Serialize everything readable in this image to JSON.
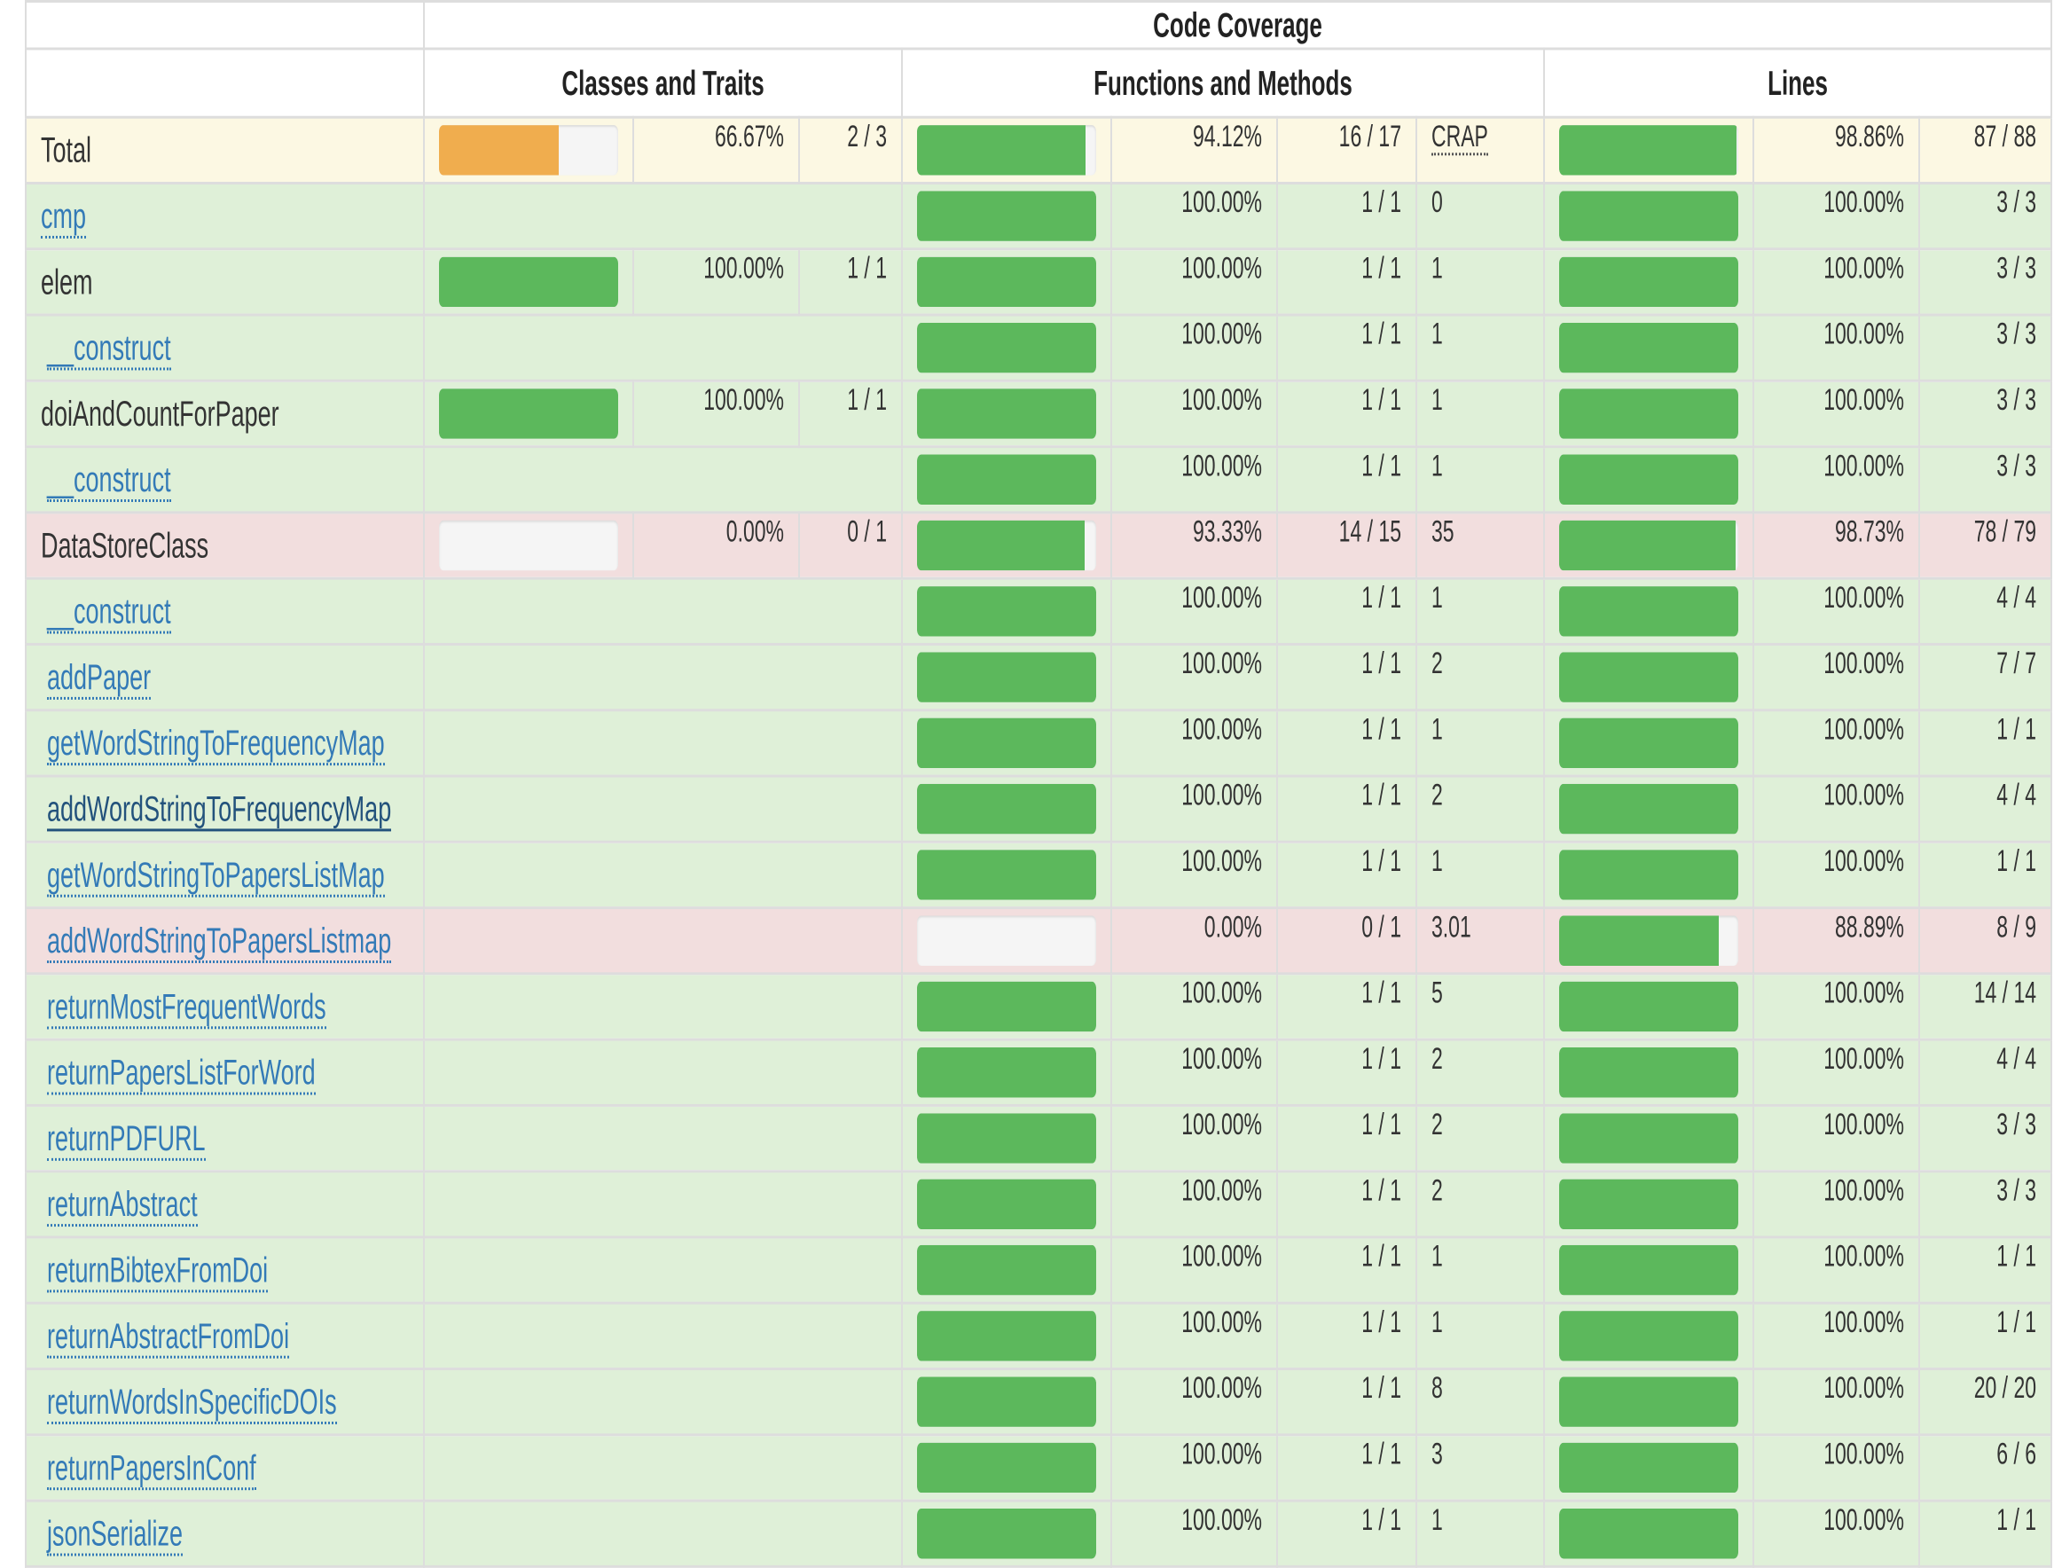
{
  "header": {
    "code_coverage": "Code Coverage",
    "classes_and_traits": "Classes and Traits",
    "functions_and_methods": "Functions and Methods",
    "lines": "Lines"
  },
  "colors": {
    "success_bar": "#5cb85c",
    "warning_bar": "#f0ad4e",
    "success_row": "#dff0d8",
    "warning_row": "#fcf8e3",
    "danger_row": "#f2dede",
    "link": "#337ab7"
  },
  "rows": [
    {
      "name": "Total",
      "link": false,
      "indent": false,
      "status": "warning",
      "classes": {
        "show": true,
        "pct": "66.67%",
        "frac": "2 / 3",
        "level": 0.6667,
        "color": "warning"
      },
      "methods": {
        "level": 0.9412,
        "pct": "94.12%",
        "frac": "16 / 17",
        "crap": "CRAP",
        "crap_abbr": true
      },
      "lines": {
        "level": 0.9886,
        "pct": "98.86%",
        "frac": "87 / 88"
      }
    },
    {
      "name": "cmp",
      "link": true,
      "indent": false,
      "status": "success",
      "classes": {
        "show": false
      },
      "methods": {
        "level": 1.0,
        "pct": "100.00%",
        "frac": "1 / 1",
        "crap": "0"
      },
      "lines": {
        "level": 1.0,
        "pct": "100.00%",
        "frac": "3 / 3"
      }
    },
    {
      "name": "elem",
      "link": false,
      "indent": false,
      "status": "success",
      "classes": {
        "show": true,
        "pct": "100.00%",
        "frac": "1 / 1",
        "level": 1.0,
        "color": "success"
      },
      "methods": {
        "level": 1.0,
        "pct": "100.00%",
        "frac": "1 / 1",
        "crap": "1"
      },
      "lines": {
        "level": 1.0,
        "pct": "100.00%",
        "frac": "3 / 3"
      }
    },
    {
      "name": "__construct",
      "link": true,
      "indent": true,
      "status": "success",
      "classes": {
        "show": false
      },
      "methods": {
        "level": 1.0,
        "pct": "100.00%",
        "frac": "1 / 1",
        "crap": "1"
      },
      "lines": {
        "level": 1.0,
        "pct": "100.00%",
        "frac": "3 / 3"
      }
    },
    {
      "name": "doiAndCountForPaper",
      "link": false,
      "indent": false,
      "status": "success",
      "classes": {
        "show": true,
        "pct": "100.00%",
        "frac": "1 / 1",
        "level": 1.0,
        "color": "success"
      },
      "methods": {
        "level": 1.0,
        "pct": "100.00%",
        "frac": "1 / 1",
        "crap": "1"
      },
      "lines": {
        "level": 1.0,
        "pct": "100.00%",
        "frac": "3 / 3"
      }
    },
    {
      "name": "__construct",
      "link": true,
      "indent": true,
      "status": "success",
      "classes": {
        "show": false
      },
      "methods": {
        "level": 1.0,
        "pct": "100.00%",
        "frac": "1 / 1",
        "crap": "1"
      },
      "lines": {
        "level": 1.0,
        "pct": "100.00%",
        "frac": "3 / 3"
      }
    },
    {
      "name": "DataStoreClass",
      "link": false,
      "indent": false,
      "status": "danger",
      "classes": {
        "show": true,
        "pct": "0.00%",
        "frac": "0 / 1",
        "level": 0.0,
        "color": "success"
      },
      "methods": {
        "level": 0.9333,
        "pct": "93.33%",
        "frac": "14 / 15",
        "crap": "35"
      },
      "lines": {
        "level": 0.9873,
        "pct": "98.73%",
        "frac": "78 / 79"
      }
    },
    {
      "name": "__construct",
      "link": true,
      "indent": true,
      "status": "success",
      "classes": {
        "show": false
      },
      "methods": {
        "level": 1.0,
        "pct": "100.00%",
        "frac": "1 / 1",
        "crap": "1"
      },
      "lines": {
        "level": 1.0,
        "pct": "100.00%",
        "frac": "4 / 4"
      }
    },
    {
      "name": "addPaper",
      "link": true,
      "indent": true,
      "status": "success",
      "classes": {
        "show": false
      },
      "methods": {
        "level": 1.0,
        "pct": "100.00%",
        "frac": "1 / 1",
        "crap": "2"
      },
      "lines": {
        "level": 1.0,
        "pct": "100.00%",
        "frac": "7 / 7"
      }
    },
    {
      "name": "getWordStringToFrequencyMap",
      "link": true,
      "indent": true,
      "status": "success",
      "classes": {
        "show": false
      },
      "methods": {
        "level": 1.0,
        "pct": "100.00%",
        "frac": "1 / 1",
        "crap": "1"
      },
      "lines": {
        "level": 1.0,
        "pct": "100.00%",
        "frac": "1 / 1"
      }
    },
    {
      "name": "addWordStringToFrequencyMap",
      "link": true,
      "indent": true,
      "status": "success",
      "hovered": true,
      "classes": {
        "show": false
      },
      "methods": {
        "level": 1.0,
        "pct": "100.00%",
        "frac": "1 / 1",
        "crap": "2"
      },
      "lines": {
        "level": 1.0,
        "pct": "100.00%",
        "frac": "4 / 4"
      }
    },
    {
      "name": "getWordStringToPapersListMap",
      "link": true,
      "indent": true,
      "status": "success",
      "classes": {
        "show": false
      },
      "methods": {
        "level": 1.0,
        "pct": "100.00%",
        "frac": "1 / 1",
        "crap": "1"
      },
      "lines": {
        "level": 1.0,
        "pct": "100.00%",
        "frac": "1 / 1"
      }
    },
    {
      "name": "addWordStringToPapersListmap",
      "link": true,
      "indent": true,
      "status": "danger",
      "classes": {
        "show": false
      },
      "methods": {
        "level": 0.0,
        "pct": "0.00%",
        "frac": "0 / 1",
        "crap": "3.01"
      },
      "lines": {
        "level": 0.8889,
        "pct": "88.89%",
        "frac": "8 / 9"
      }
    },
    {
      "name": "returnMostFrequentWords",
      "link": true,
      "indent": true,
      "status": "success",
      "classes": {
        "show": false
      },
      "methods": {
        "level": 1.0,
        "pct": "100.00%",
        "frac": "1 / 1",
        "crap": "5"
      },
      "lines": {
        "level": 1.0,
        "pct": "100.00%",
        "frac": "14 / 14"
      }
    },
    {
      "name": "returnPapersListForWord",
      "link": true,
      "indent": true,
      "status": "success",
      "classes": {
        "show": false
      },
      "methods": {
        "level": 1.0,
        "pct": "100.00%",
        "frac": "1 / 1",
        "crap": "2"
      },
      "lines": {
        "level": 1.0,
        "pct": "100.00%",
        "frac": "4 / 4"
      }
    },
    {
      "name": "returnPDFURL",
      "link": true,
      "indent": true,
      "status": "success",
      "classes": {
        "show": false
      },
      "methods": {
        "level": 1.0,
        "pct": "100.00%",
        "frac": "1 / 1",
        "crap": "2"
      },
      "lines": {
        "level": 1.0,
        "pct": "100.00%",
        "frac": "3 / 3"
      }
    },
    {
      "name": "returnAbstract",
      "link": true,
      "indent": true,
      "status": "success",
      "classes": {
        "show": false
      },
      "methods": {
        "level": 1.0,
        "pct": "100.00%",
        "frac": "1 / 1",
        "crap": "2"
      },
      "lines": {
        "level": 1.0,
        "pct": "100.00%",
        "frac": "3 / 3"
      }
    },
    {
      "name": "returnBibtexFromDoi",
      "link": true,
      "indent": true,
      "status": "success",
      "classes": {
        "show": false
      },
      "methods": {
        "level": 1.0,
        "pct": "100.00%",
        "frac": "1 / 1",
        "crap": "1"
      },
      "lines": {
        "level": 1.0,
        "pct": "100.00%",
        "frac": "1 / 1"
      }
    },
    {
      "name": "returnAbstractFromDoi",
      "link": true,
      "indent": true,
      "status": "success",
      "classes": {
        "show": false
      },
      "methods": {
        "level": 1.0,
        "pct": "100.00%",
        "frac": "1 / 1",
        "crap": "1"
      },
      "lines": {
        "level": 1.0,
        "pct": "100.00%",
        "frac": "1 / 1"
      }
    },
    {
      "name": "returnWordsInSpecificDOIs",
      "link": true,
      "indent": true,
      "status": "success",
      "classes": {
        "show": false
      },
      "methods": {
        "level": 1.0,
        "pct": "100.00%",
        "frac": "1 / 1",
        "crap": "8"
      },
      "lines": {
        "level": 1.0,
        "pct": "100.00%",
        "frac": "20 / 20"
      }
    },
    {
      "name": "returnPapersInConf",
      "link": true,
      "indent": true,
      "status": "success",
      "classes": {
        "show": false
      },
      "methods": {
        "level": 1.0,
        "pct": "100.00%",
        "frac": "1 / 1",
        "crap": "3"
      },
      "lines": {
        "level": 1.0,
        "pct": "100.00%",
        "frac": "6 / 6"
      }
    },
    {
      "name": "jsonSerialize",
      "link": true,
      "indent": true,
      "status": "success",
      "classes": {
        "show": false
      },
      "methods": {
        "level": 1.0,
        "pct": "100.00%",
        "frac": "1 / 1",
        "crap": "1"
      },
      "lines": {
        "level": 1.0,
        "pct": "100.00%",
        "frac": "1 / 1"
      }
    }
  ]
}
